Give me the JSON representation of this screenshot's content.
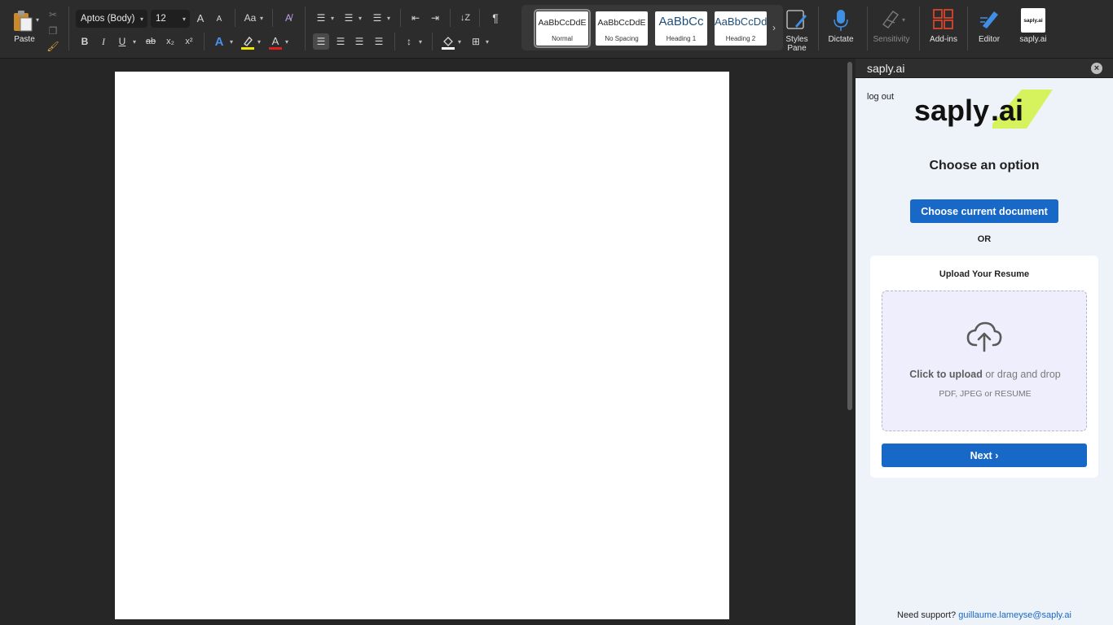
{
  "ribbon": {
    "paste_label": "Paste",
    "font_name": "Aptos (Body)",
    "font_size": "12",
    "bold": "B",
    "italic": "I",
    "underline": "U",
    "strikethrough": "ab",
    "subscript": "x₂",
    "superscript": "x²",
    "grow_font": "A",
    "shrink_font": "A",
    "change_case": "Aa",
    "show_formatting": "¶",
    "styles": [
      {
        "preview": "AaBbCcDdE",
        "name": "Normal"
      },
      {
        "preview": "AaBbCcDdE",
        "name": "No Spacing"
      },
      {
        "preview": "AaBbCc",
        "name": "Heading 1"
      },
      {
        "preview": "AaBbCcDd",
        "name": "Heading 2"
      }
    ],
    "styles_pane_label": "Styles Pane",
    "dictate_label": "Dictate",
    "sensitivity_label": "Sensitivity",
    "addins_label": "Add-ins",
    "editor_label": "Editor",
    "saply_label": "saply.ai",
    "saply_icon_text": "saply.ai"
  },
  "pane": {
    "title": "saply.ai",
    "logout": "log out",
    "brand_main": "saply",
    "brand_ext": ".ai",
    "heading": "Choose an option",
    "choose_current_button": "Choose current document",
    "or": "OR",
    "upload_title": "Upload Your Resume",
    "drop_click": "Click to upload",
    "drop_rest": " or drag and drop",
    "drop_formats": "PDF, JPEG or RESUME",
    "next_button": "Next ›",
    "support_prefix": "Need support? ",
    "support_email": "guillaume.lameyse@saply.ai"
  },
  "colors": {
    "accent_blue": "#1868c8",
    "brand_lime": "#d6f25c",
    "pane_bg": "#eef3fa",
    "ribbon_bg": "#2c2c2c"
  }
}
